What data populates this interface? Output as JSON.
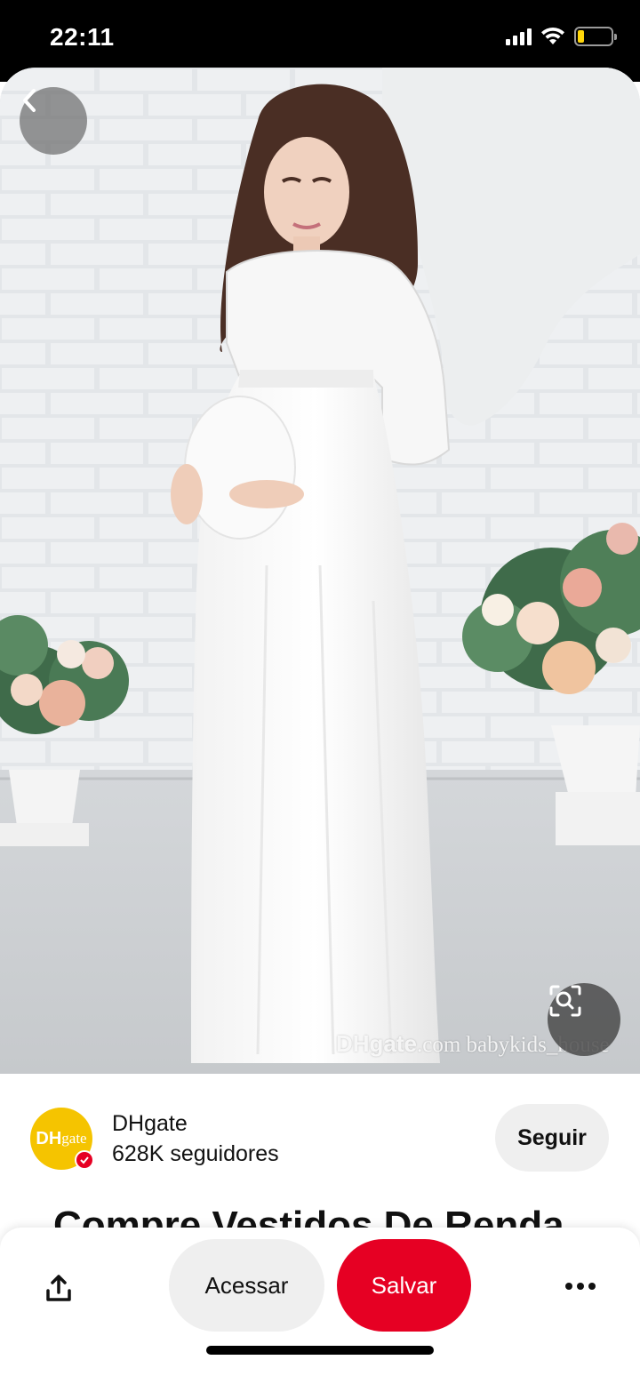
{
  "status_bar": {
    "time": "22:11",
    "icons": [
      "signal-icon",
      "wifi-icon",
      "battery-icon"
    ],
    "battery_level": 0.2,
    "battery_color": "#ffd60a"
  },
  "pin": {
    "image_description_icon": "photo",
    "watermark_brand": "DHgate",
    "watermark_suffix": ".com  babykids_house",
    "back_icon": "chevron-left-icon",
    "visual_search_icon": "lens-search-icon"
  },
  "creator": {
    "avatar_text": "DH",
    "avatar_text_small": "gate",
    "avatar_color": "#f5c400",
    "name": "DHgate",
    "followers": "628K seguidores",
    "follow_label": "Seguir"
  },
  "title": "Compre Vestidos De Renda",
  "actions": {
    "share_icon": "share-icon",
    "visit_label": "Acessar",
    "save_label": "Salvar",
    "save_color": "#e60023",
    "more_icon": "more-dots-icon"
  }
}
